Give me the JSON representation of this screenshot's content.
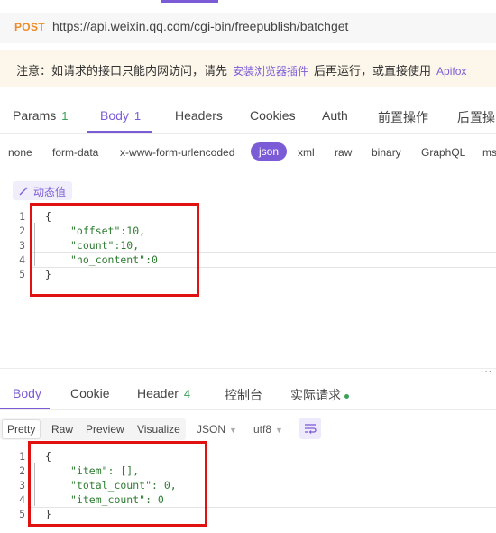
{
  "request": {
    "method": "POST",
    "url": "https://api.weixin.qq.com/cgi-bin/freepublish/batchget"
  },
  "notice": {
    "prefix": "注意：如请求的接口只能内网访问，请先",
    "link1": "安装浏览器插件",
    "middle": "后再运行，或直接使用",
    "link2": "Apifox"
  },
  "request_tabs": [
    {
      "label": "Params",
      "count": "1"
    },
    {
      "label": "Body",
      "count": "1"
    },
    {
      "label": "Headers",
      "count": ""
    },
    {
      "label": "Cookies",
      "count": ""
    },
    {
      "label": "Auth",
      "count": ""
    },
    {
      "label": "前置操作",
      "count": ""
    },
    {
      "label": "后置操",
      "count": ""
    }
  ],
  "body_types": [
    "none",
    "form-data",
    "x-www-form-urlencoded",
    "json",
    "xml",
    "raw",
    "binary",
    "GraphQL",
    "ms"
  ],
  "dynamic_value_label": "动态值",
  "request_body_lines": [
    "{",
    "\"offset\":10,",
    "\"count\":10,",
    "\"no_content\":0",
    "}"
  ],
  "response_tabs": [
    {
      "label": "Body",
      "count": ""
    },
    {
      "label": "Cookie",
      "count": ""
    },
    {
      "label": "Header",
      "count": "4"
    },
    {
      "label": "控制台",
      "count": ""
    },
    {
      "label": "实际请求",
      "count": ""
    }
  ],
  "response_view": {
    "modes": [
      "Pretty",
      "Raw",
      "Preview",
      "Visualize"
    ],
    "format": "JSON",
    "encoding": "utf8"
  },
  "response_body_lines": [
    "{",
    "\"item\": [],",
    "\"total_count\": 0,",
    "\"item_count\": 0",
    "}"
  ],
  "colors": {
    "accent": "#7c5cd6",
    "method": "#f08a24",
    "highlight_box": "#e11111",
    "count": "#3aa05a"
  }
}
